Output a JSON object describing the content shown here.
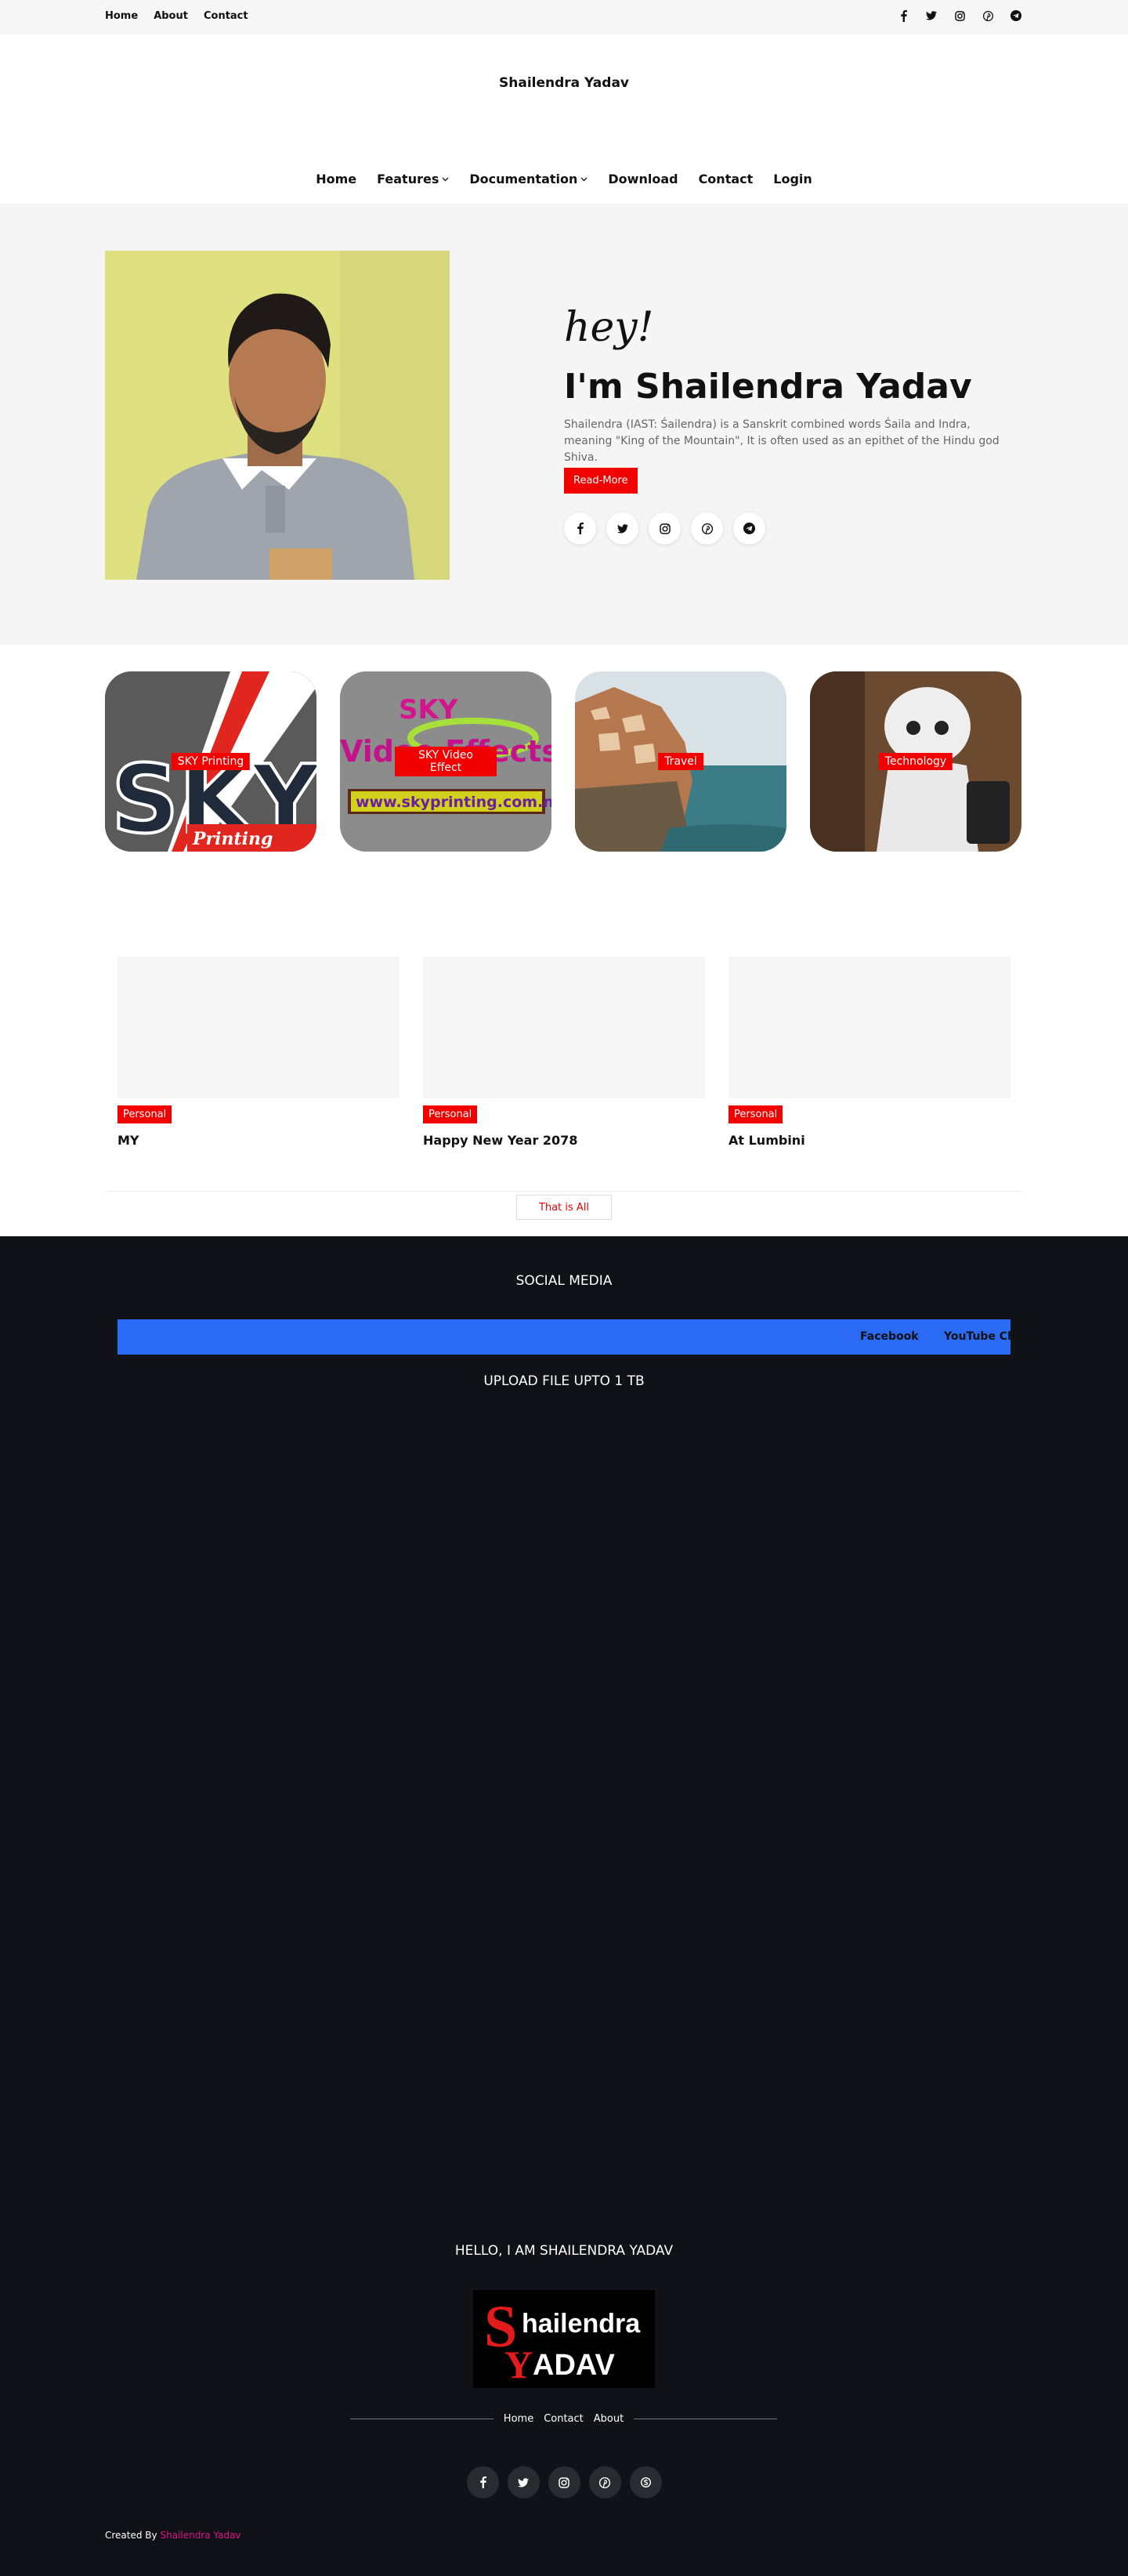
{
  "topbar": {
    "links": [
      "Home",
      "About",
      "Contact"
    ],
    "social_icons": [
      "facebook-icon",
      "twitter-icon",
      "instagram-icon",
      "pinterest-icon",
      "telegram-icon"
    ]
  },
  "header": {
    "site_title": "Shailendra Yadav"
  },
  "nav": {
    "items": [
      "Home",
      "Features",
      "Documentation",
      "Download",
      "Contact",
      "Login"
    ],
    "dropdown_items": [
      "Features",
      "Documentation"
    ]
  },
  "hero": {
    "greeting": "hey!",
    "heading": "I'm Shailendra Yadav",
    "description": "Shailendra (IAST: Śailendra) is a Sanskrit combined words Śaila and Indra, meaning \"King of the Mountain\", It is often used as an epithet of the Hindu god Shiva.",
    "button": "Read-More",
    "social_icons": [
      "facebook-icon",
      "twitter-icon",
      "instagram-icon",
      "pinterest-icon",
      "telegram-icon"
    ]
  },
  "categories": [
    {
      "label": "SKY Printing"
    },
    {
      "label": "SKY Video Effect",
      "image_text_top": "SKY",
      "image_text_mid": "Video Effects",
      "image_text_url": "www.skyprinting.com.np"
    },
    {
      "label": "Travel"
    },
    {
      "label": "Technology"
    }
  ],
  "category_sky_image": {
    "big": "SKY",
    "small": "Printing"
  },
  "posts": [
    {
      "tag": "Personal",
      "title": "MY"
    },
    {
      "tag": "Personal",
      "title": "Happy New Year 2078"
    },
    {
      "tag": "Personal",
      "title": "At Lumbini"
    }
  ],
  "more_button": "That is All",
  "footer": {
    "social_media_title": "SOCIAL MEDIA",
    "marquee": [
      "Facebook",
      "YouTube Channel"
    ],
    "upload_title": "UPLOAD FILE UPTO 1 TB",
    "hello_title": "HELLO, I AM SHAILENDRA YADAV",
    "logo": {
      "letter": "S",
      "line1": "hailendra",
      "letter2": "Y",
      "line2": "ADAV"
    },
    "nav": [
      "Home",
      "Contact",
      "About"
    ],
    "social_icons": [
      "facebook-icon",
      "twitter-icon",
      "instagram-icon",
      "pinterest-icon",
      "skype-icon"
    ],
    "credit_prefix": "Created By",
    "credit_name": "Shailendra Yadav"
  },
  "colors": {
    "accent": "#f20000",
    "footer_bg": "#111217",
    "marquee_bg": "#2b6af5",
    "credit": "#e0118a"
  }
}
